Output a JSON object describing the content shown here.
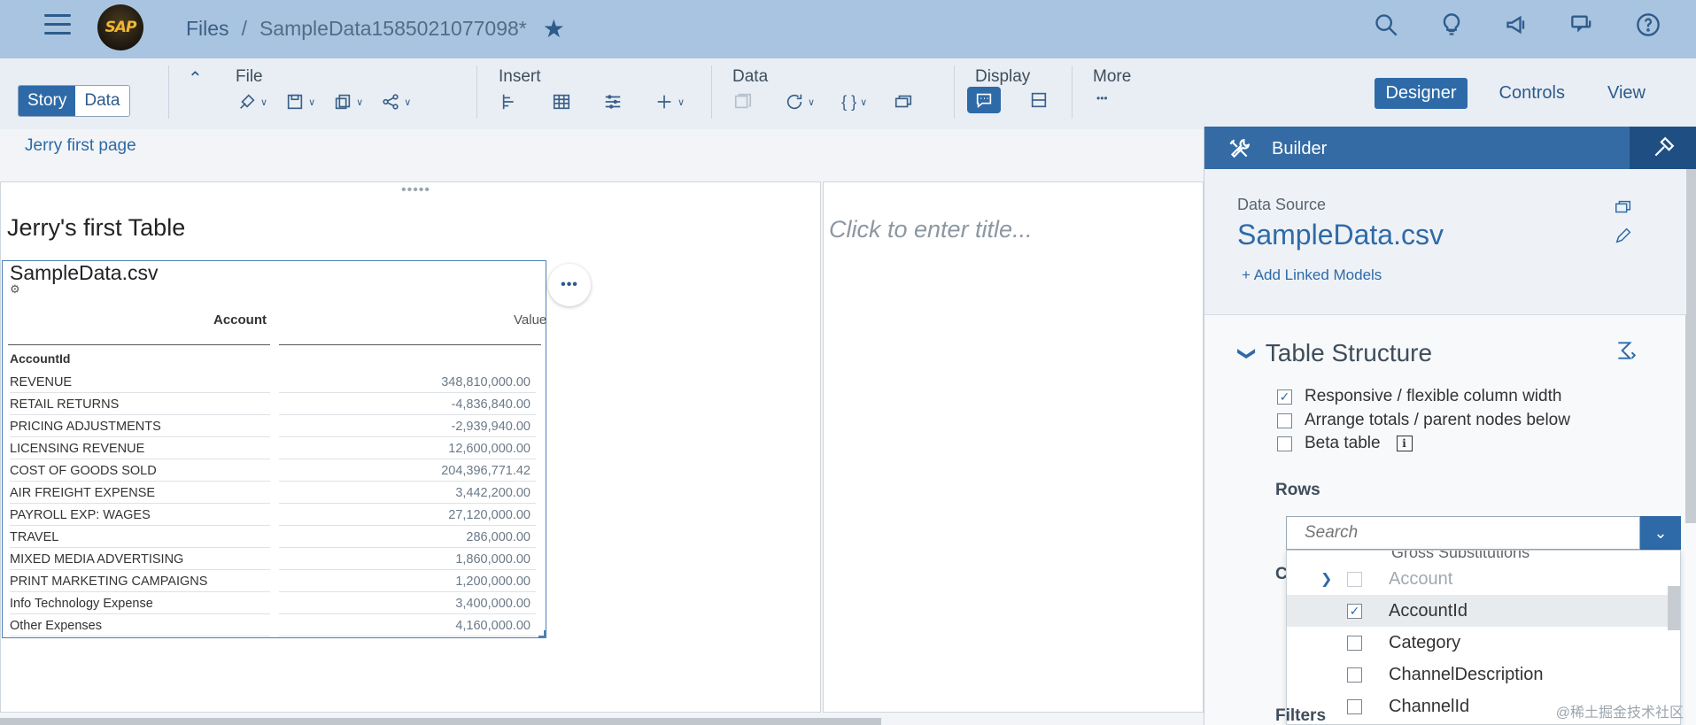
{
  "shell": {
    "logo_text": "SAP",
    "breadcrumb_root": "Files",
    "breadcrumb_sep": "/",
    "breadcrumb_file": "SampleData1585021077098*",
    "icons": [
      "search-icon",
      "lightbulb-icon",
      "megaphone-icon",
      "chat-icon",
      "help-icon"
    ]
  },
  "toolbar": {
    "mode_story": "Story",
    "mode_data": "Data",
    "file_label": "File",
    "insert_label": "Insert",
    "data_label": "Data",
    "display_label": "Display",
    "more_label": "More",
    "more_dots": "•••",
    "tabs": {
      "designer": "Designer",
      "controls": "Controls",
      "view": "View"
    }
  },
  "page_tab": "Jerry first page",
  "canvas": {
    "grip": "•••••",
    "title": "Jerry's first Table",
    "right_placeholder": "Click to enter title..."
  },
  "table": {
    "title": "SampleData.csv",
    "model_icon": "⚙",
    "more_button": "•••",
    "header_account": "Account",
    "header_value": "Value",
    "dimension": "AccountId",
    "rows": [
      {
        "account": "REVENUE",
        "value": "348,810,000.00"
      },
      {
        "account": "RETAIL RETURNS",
        "value": "-4,836,840.00"
      },
      {
        "account": "PRICING ADJUSTMENTS",
        "value": "-2,939,940.00"
      },
      {
        "account": "LICENSING REVENUE",
        "value": "12,600,000.00"
      },
      {
        "account": "COST OF GOODS SOLD",
        "value": "204,396,771.42"
      },
      {
        "account": "AIR FREIGHT EXPENSE",
        "value": "3,442,200.00"
      },
      {
        "account": "PAYROLL EXP: WAGES",
        "value": "27,120,000.00"
      },
      {
        "account": "TRAVEL",
        "value": "286,000.00"
      },
      {
        "account": "MIXED MEDIA ADVERTISING",
        "value": "1,860,000.00"
      },
      {
        "account": "PRINT MARKETING CAMPAIGNS",
        "value": "1,200,000.00"
      },
      {
        "account": "Info Technology Expense",
        "value": "3,400,000.00"
      },
      {
        "account": "Other Expenses",
        "value": "4,160,000.00"
      }
    ]
  },
  "builder": {
    "title": "Builder",
    "data_source_label": "Data Source",
    "data_source_name": "SampleData.csv",
    "add_linked_models": "+ Add Linked Models",
    "section_title": "Table Structure",
    "section_chevron": "❯",
    "options": [
      {
        "label": "Responsive / flexible column width",
        "checked": true
      },
      {
        "label": "Arrange totals / parent nodes below",
        "checked": false
      },
      {
        "label": "Beta table",
        "checked": false
      }
    ],
    "info_glyph": "i",
    "rows_label": "Rows",
    "search_placeholder": "Search",
    "search_chevron": "⌄",
    "dropdown_cut": "Gross Substitutions",
    "dropdown_items": [
      {
        "label": "Account",
        "checked": false,
        "disabled": true,
        "expandable": true
      },
      {
        "label": "AccountId",
        "checked": true,
        "disabled": false,
        "expandable": false
      },
      {
        "label": "Category",
        "checked": false,
        "disabled": false,
        "expandable": false
      },
      {
        "label": "ChannelDescription",
        "checked": false,
        "disabled": false,
        "expandable": false
      },
      {
        "label": "ChannelId",
        "checked": false,
        "disabled": false,
        "expandable": false
      }
    ],
    "columns_partial": "C",
    "filters_label": "Filters"
  },
  "watermark": "@稀土掘金技术社区",
  "colors": {
    "shell": "#a9c4e0",
    "accent": "#2e6aa8",
    "builder_head": "#346ba4"
  }
}
